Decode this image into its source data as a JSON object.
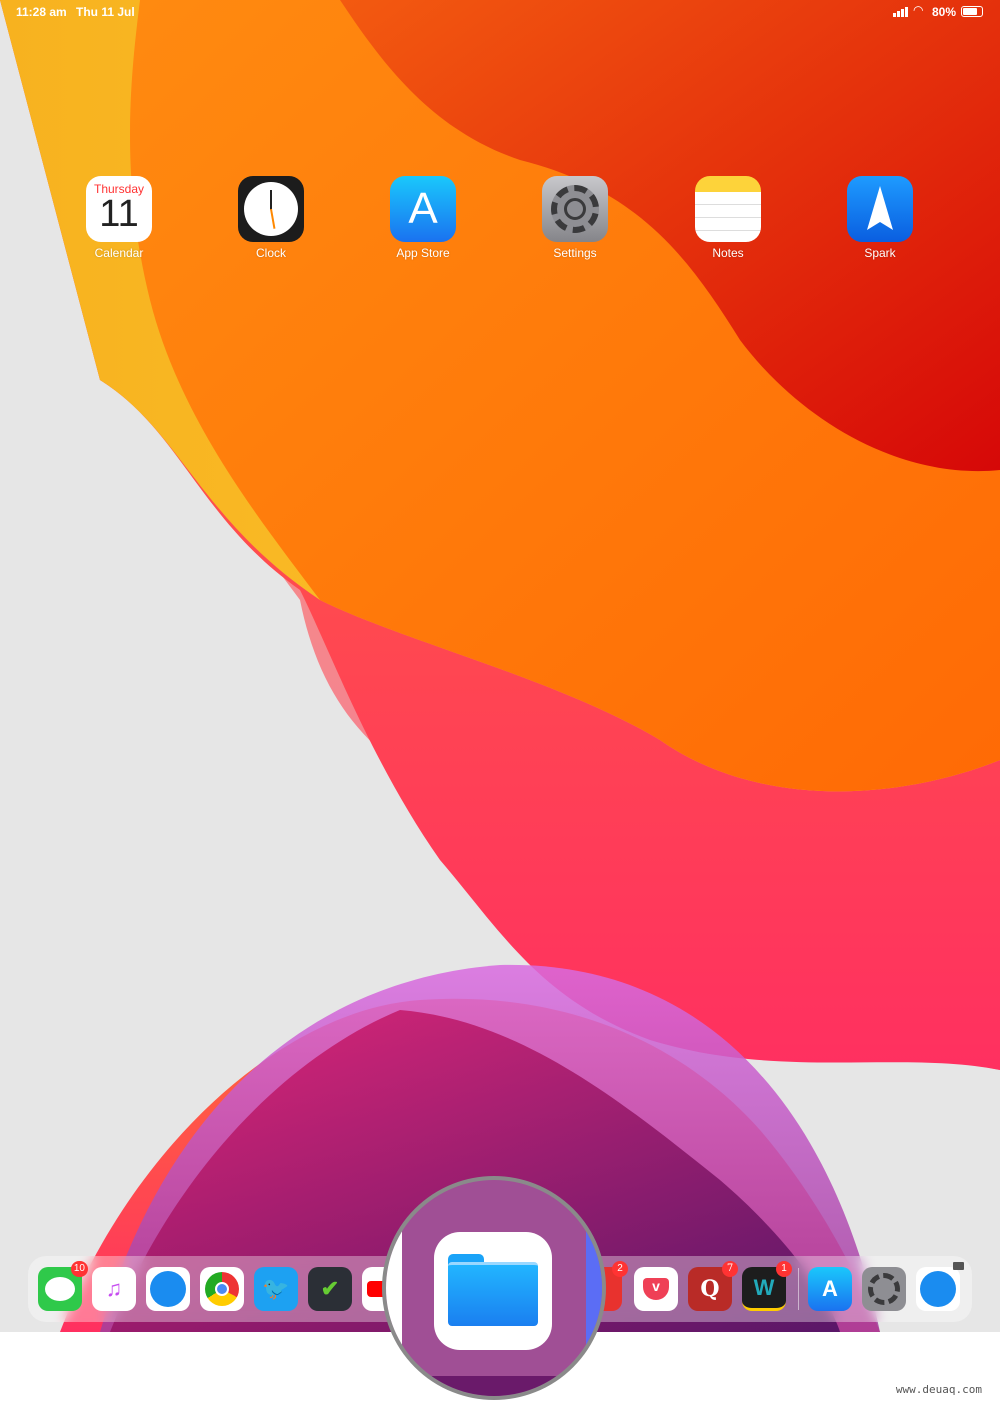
{
  "status_bar": {
    "time": "11:28 am",
    "date": "Thu 11 Jul",
    "battery": "80%",
    "battery_level": 0.8
  },
  "home_apps": [
    {
      "label": "Calendar",
      "day": "Thursday",
      "date": "11"
    },
    {
      "label": "Clock"
    },
    {
      "label": "App Store"
    },
    {
      "label": "Settings"
    },
    {
      "label": "Notes"
    },
    {
      "label": "Spark"
    }
  ],
  "dock": {
    "apps": [
      {
        "name": "Messages",
        "badge": "10",
        "color": "#2fc94a"
      },
      {
        "name": "Music",
        "color": "#ffffff"
      },
      {
        "name": "Safari",
        "color": "#ffffff"
      },
      {
        "name": "Chrome",
        "color": "#ffffff"
      },
      {
        "name": "Twitter",
        "color": "#1da1f2"
      },
      {
        "name": "Tasks",
        "color": "#2b2f36"
      },
      {
        "name": "YouTube",
        "color": "#ffffff"
      }
    ],
    "magnified_app": "Files",
    "right_apps": [
      {
        "name": "Partial red app",
        "badge": "2",
        "color": "#e8322e"
      },
      {
        "name": "Pocket",
        "color": "#ffffff"
      },
      {
        "name": "Quora",
        "badge": "7",
        "color": "#b92b27",
        "glyph": "Q"
      },
      {
        "name": "Wunderlist",
        "badge": "1",
        "color": "#1d1d1d",
        "glyph": "W"
      }
    ],
    "recent_apps": [
      {
        "name": "App Store",
        "color": "#1c8cf7"
      },
      {
        "name": "Settings",
        "color": "#8e8e93"
      },
      {
        "name": "Safari",
        "color": "#ffffff"
      }
    ]
  },
  "watermark": "www.deuaq.com"
}
